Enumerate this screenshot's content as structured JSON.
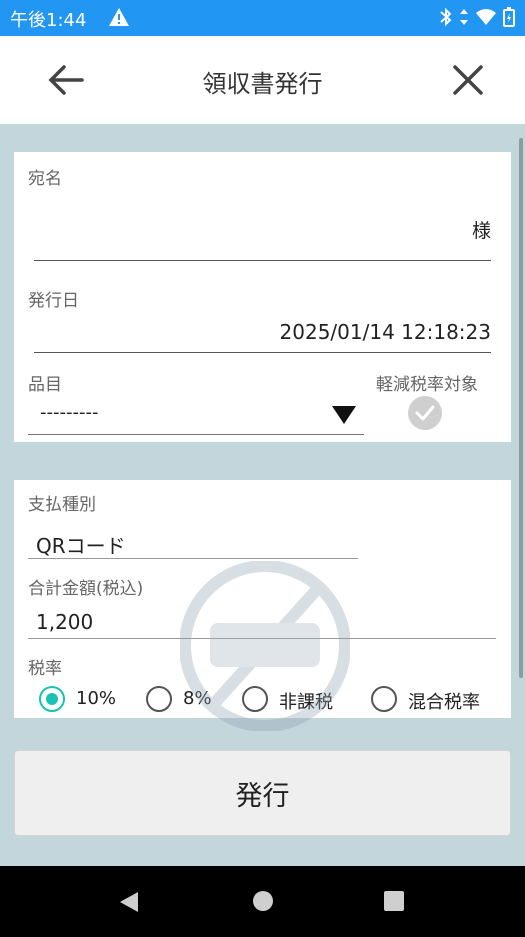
{
  "status_bar": {
    "time": "午後1:44"
  },
  "app_bar": {
    "title": "領収書発行"
  },
  "form": {
    "addressee_label": "宛名",
    "addressee_value": "",
    "addressee_suffix": "様",
    "issue_date_label": "発行日",
    "issue_date_value": "2025/01/14 12:18:23",
    "item_label": "品目",
    "item_value": "---------",
    "reduced_tax_label": "軽減税率対象",
    "payment_type_label": "支払種別",
    "payment_type_value": "QRコード",
    "total_label": "合計金額(税込)",
    "total_value": "1,200",
    "tax_rate_label": "税率",
    "tax_options": [
      {
        "label": "10%",
        "selected": true
      },
      {
        "label": "8%",
        "selected": false
      },
      {
        "label": "非課税",
        "selected": false
      },
      {
        "label": "混合税率",
        "selected": false
      }
    ]
  },
  "issue_button_label": "発行",
  "colors": {
    "status_bar": "#2196f3",
    "accent": "#19c2b6",
    "content_bg": "#c3d6db"
  }
}
